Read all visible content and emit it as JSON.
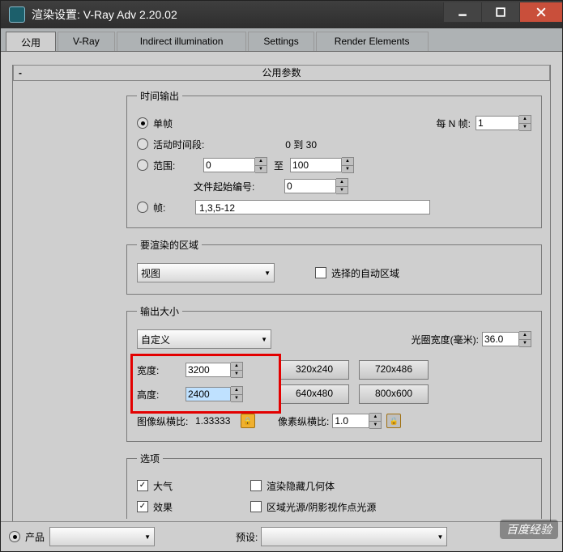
{
  "window": {
    "title": "渲染设置: V-Ray Adv 2.20.02"
  },
  "tabs": {
    "common": "公用",
    "vray": "V-Ray",
    "ii": "Indirect illumination",
    "settings": "Settings",
    "re": "Render Elements"
  },
  "rollup": {
    "title": "公用参数"
  },
  "time": {
    "legend": "时间输出",
    "single": "单帧",
    "everyN": "每 N 帧:",
    "everyN_val": "1",
    "active": "活动时间段:",
    "active_range": "0 到 30",
    "range": "范围:",
    "range_a": "0",
    "to": "至",
    "range_b": "100",
    "fileStart": "文件起始编号:",
    "fileStart_val": "0",
    "frames": "帧:",
    "frames_val": "1,3,5-12"
  },
  "area": {
    "legend": "要渲染的区域",
    "preset": "视图",
    "auto": "选择的自动区域"
  },
  "size": {
    "legend": "输出大小",
    "preset": "自定义",
    "aperture": "光圈宽度(毫米):",
    "aperture_val": "36.0",
    "width": "宽度:",
    "width_val": "3200",
    "height": "高度:",
    "height_val": "2400",
    "b1": "320x240",
    "b2": "720x486",
    "b3": "640x480",
    "b4": "800x600",
    "imgAspect": "图像纵横比:",
    "imgAspect_val": "1.33333",
    "pixAspect": "像素纵横比:",
    "pixAspect_val": "1.0"
  },
  "opt": {
    "legend": "选项",
    "atmos": "大气",
    "hidden": "渲染隐藏几何体",
    "effects": "效果",
    "areaShadow": "区域光源/阴影视作点光源"
  },
  "bottom": {
    "product": "产品",
    "preset": "预设:"
  },
  "watermark": "百度经验"
}
